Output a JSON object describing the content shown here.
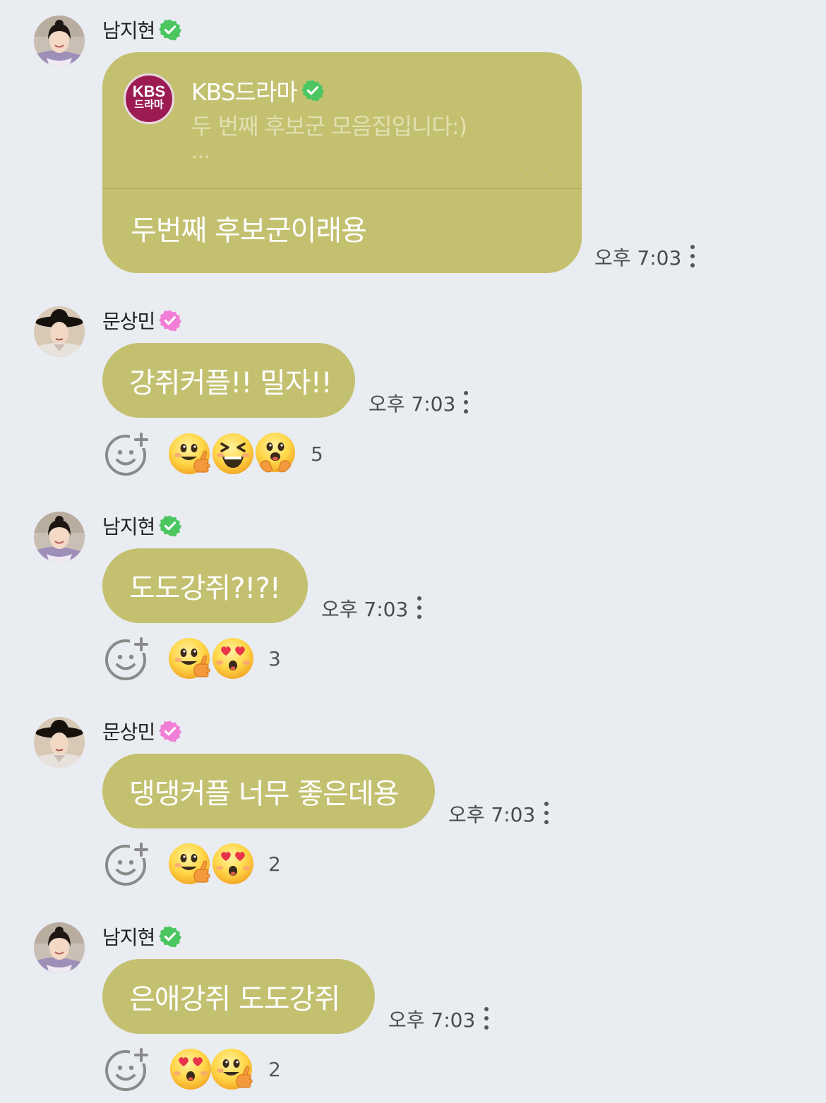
{
  "colors": {
    "background": "#e9ecf1",
    "bubble": "#c3c070",
    "verified_green": "#4cc660",
    "verified_pink": "#f27fd6",
    "bubble_text": "#ffffff"
  },
  "messages": [
    {
      "sender": "남지현",
      "verified": "green",
      "avatar": "avatar-namjihyun",
      "quote": {
        "logo_line1": "KBS",
        "logo_line2": "드라마",
        "author": "KBS드라마",
        "preview": "두 번째 후보군 모음집입니다:)",
        "ellipsis": "...",
        "dots": "· · ·"
      },
      "text": "두번째 후보군이래용",
      "time": "오후 7:03"
    },
    {
      "sender": "문상민",
      "verified": "pink",
      "avatar": "avatar-moonsangmin",
      "text": "강쥐커플!! 밀자!!",
      "time": "오후 7:03",
      "reactions": {
        "emojis": [
          "thumbs-up-emoji",
          "laughing-emoji",
          "excited-emoji"
        ],
        "count": "5"
      }
    },
    {
      "sender": "남지현",
      "verified": "green",
      "avatar": "avatar-namjihyun",
      "text": "도도강쥐?!?!",
      "time": "오후 7:03",
      "reactions": {
        "emojis": [
          "thumbs-up-emoji",
          "heart-eyes-emoji"
        ],
        "count": "3"
      }
    },
    {
      "sender": "문상민",
      "verified": "pink",
      "avatar": "avatar-moonsangmin",
      "text": "댕댕커플 너무 좋은데용",
      "time": "오후 7:03",
      "reactions": {
        "emojis": [
          "thumbs-up-emoji",
          "heart-eyes-emoji"
        ],
        "count": "2"
      }
    },
    {
      "sender": "남지현",
      "verified": "green",
      "avatar": "avatar-namjihyun",
      "text": "은애강쥐 도도강쥐",
      "time": "오후 7:03",
      "reactions": {
        "emojis": [
          "heart-eyes-emoji",
          "thumbs-up-emoji"
        ],
        "count": "2"
      }
    }
  ]
}
